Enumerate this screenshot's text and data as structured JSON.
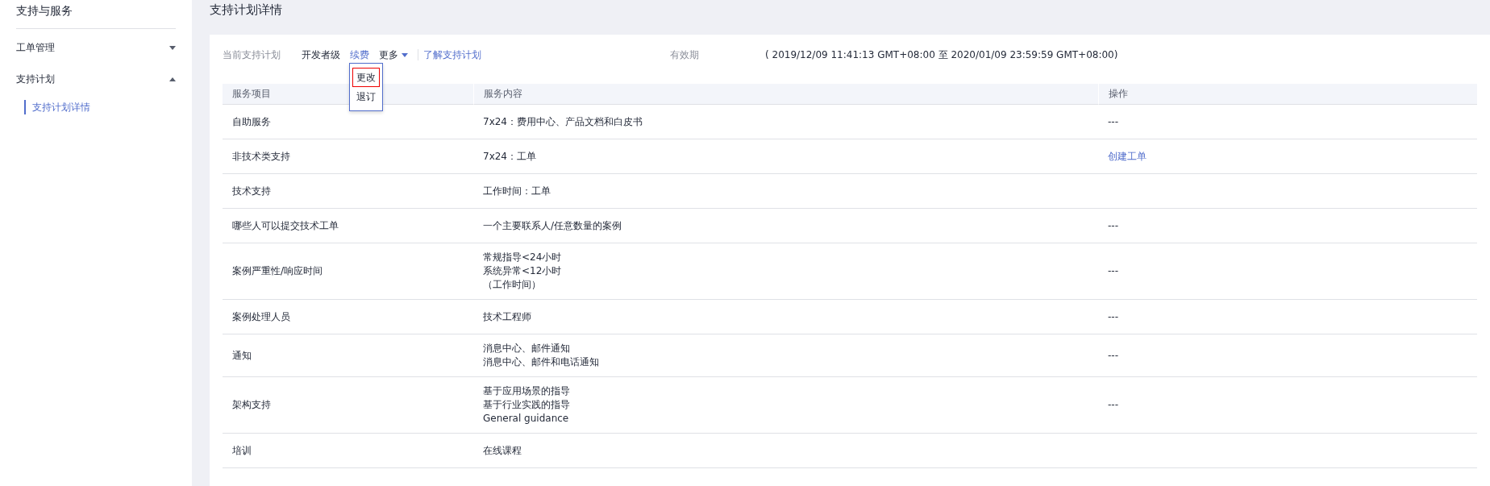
{
  "sidebar": {
    "title": "支持与服务",
    "items": [
      {
        "label": "工单管理",
        "expanded": false
      },
      {
        "label": "支持计划",
        "expanded": true,
        "children": [
          {
            "label": "支持计划详情",
            "selected": true
          }
        ]
      }
    ]
  },
  "page_title": "支持计划详情",
  "plan": {
    "label": "当前支持计划",
    "level": "开发者级",
    "renew": "续费",
    "more": "更多",
    "more_menu": [
      {
        "label": "更改",
        "highlighted": true
      },
      {
        "label": "退订",
        "highlighted": false
      }
    ],
    "learn_link": "了解支持计划",
    "validity_label": "有效期",
    "validity": "( 2019/12/09 11:41:13 GMT+08:00 至 2020/01/09 23:59:59 GMT+08:00)"
  },
  "table": {
    "columns": [
      "服务项目",
      "服务内容",
      "操作"
    ],
    "rows": [
      {
        "item": "自助服务",
        "content": [
          "7x24：费用中心、产品文档和白皮书"
        ],
        "action": {
          "kind": "text",
          "text": "---"
        }
      },
      {
        "item": "非技术类支持",
        "content": [
          "7x24：工单"
        ],
        "action": {
          "kind": "link",
          "text": "创建工单"
        }
      },
      {
        "item": "技术支持",
        "content": [
          "工作时间：工单"
        ]
      },
      {
        "item": "哪些人可以提交技术工单",
        "content": [
          "一个主要联系人/任意数量的案例"
        ],
        "action": {
          "kind": "text",
          "text": "---"
        }
      },
      {
        "item": "案例严重性/响应时间",
        "content": [
          "常规指导<24小时",
          "系统异常<12小时",
          "（工作时间）"
        ],
        "action": {
          "kind": "text",
          "text": "---"
        }
      },
      {
        "item": "案例处理人员",
        "content": [
          "技术工程师"
        ],
        "action": {
          "kind": "text",
          "text": "---"
        }
      },
      {
        "item": "通知",
        "content": [
          "消息中心、邮件通知",
          "消息中心、邮件和电话通知"
        ],
        "action": {
          "kind": "text",
          "text": "---"
        }
      },
      {
        "item": "架构支持",
        "content": [
          "基于应用场景的指导",
          "基于行业实践的指导",
          "General guidance"
        ],
        "action": {
          "kind": "text",
          "text": "---"
        }
      },
      {
        "item": "培训",
        "content": [
          "在线课程"
        ]
      }
    ]
  }
}
